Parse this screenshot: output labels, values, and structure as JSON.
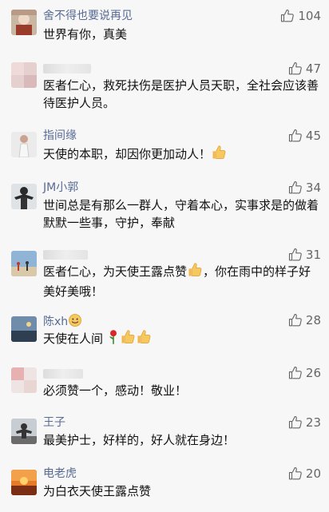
{
  "comments": [
    {
      "name": "舍不得也要说再见",
      "text": "世界有你，真美",
      "likes": "104"
    },
    {
      "name": "",
      "text": "医者仁心，救死扶伤是医护人员天职，全社会应该善待医护人员。",
      "likes": "47"
    },
    {
      "name": "指间缘",
      "text": "天使的本职，却因你更加动人！",
      "likes": "45"
    },
    {
      "name": "JM小郭",
      "text": "世间总是有那么一群人，守着本心，实事求是的做着默默一些事，守护，奉献",
      "likes": "34"
    },
    {
      "name": "",
      "text": "医者仁心，为天使王露点赞",
      "text2": "，你在雨中的样子好美好美哦！",
      "likes": "31"
    },
    {
      "name": "陈xh",
      "text": "天使在人间",
      "likes": "28"
    },
    {
      "name": "",
      "text": "必须赞一个，感动！敬业！",
      "likes": "26"
    },
    {
      "name": "王子",
      "text": "最美护士，好样的，好人就在身边！",
      "likes": "23"
    },
    {
      "name": "电老虎",
      "text": "为白衣天使王露点赞",
      "likes": "20"
    }
  ],
  "icons": {
    "like": "thumbs-up-outline-icon",
    "emoji_thumb": "thumbs-up-emoji-icon",
    "emoji_rose": "rose-emoji-icon",
    "emoji_smile": "smile-emoji-icon"
  },
  "colors": {
    "name": "#576b95",
    "text": "#111111",
    "likes": "#666666",
    "background": "#f7f7f7"
  }
}
